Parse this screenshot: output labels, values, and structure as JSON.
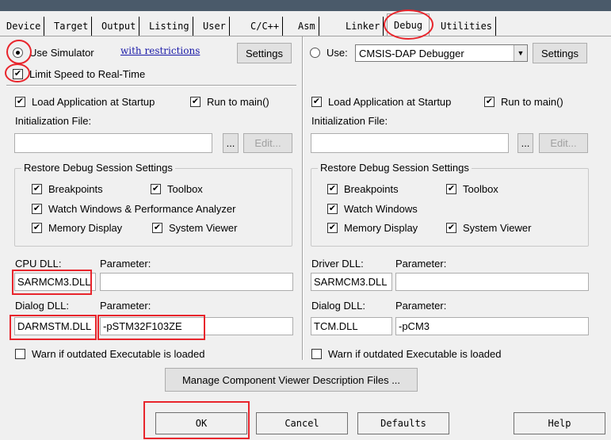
{
  "tabs": [
    {
      "label": "Device"
    },
    {
      "label": "Target"
    },
    {
      "label": "Output"
    },
    {
      "label": "Listing"
    },
    {
      "label": "User"
    },
    {
      "label": "C/C++"
    },
    {
      "label": "Asm"
    },
    {
      "label": "Linker"
    },
    {
      "label": "Debug"
    },
    {
      "label": "Utilities"
    }
  ],
  "active_tab": "Debug",
  "left": {
    "use_simulator": "Use Simulator",
    "restrictions_link": "with restrictions",
    "settings": "Settings",
    "limit_speed": "Limit Speed to Real-Time",
    "load_app": "Load Application at Startup",
    "run_to_main": "Run to main()",
    "init_file_label": "Initialization File:",
    "init_file_value": "",
    "browse": "...",
    "edit": "Edit...",
    "restore_legend": "Restore Debug Session Settings",
    "breakpoints": "Breakpoints",
    "toolbox": "Toolbox",
    "watch_windows": "Watch Windows & Performance Analyzer",
    "memory_display": "Memory Display",
    "system_viewer": "System Viewer",
    "cpu_dll_label": "CPU DLL:",
    "cpu_param_label": "Parameter:",
    "cpu_dll_value": "SARMCM3.DLL",
    "cpu_param_value": "",
    "dialog_dll_label": "Dialog DLL:",
    "dialog_param_label": "Parameter:",
    "dialog_dll_value": "DARMSTM.DLL",
    "dialog_param_value": "-pSTM32F103ZE",
    "warn": "Warn if outdated Executable is loaded"
  },
  "right": {
    "use": "Use:",
    "debugger": "CMSIS-DAP Debugger",
    "settings": "Settings",
    "load_app": "Load Application at Startup",
    "run_to_main": "Run to main()",
    "init_file_label": "Initialization File:",
    "init_file_value": "",
    "browse": "...",
    "edit": "Edit...",
    "restore_legend": "Restore Debug Session Settings",
    "breakpoints": "Breakpoints",
    "toolbox": "Toolbox",
    "watch_windows": "Watch Windows",
    "memory_display": "Memory Display",
    "system_viewer": "System Viewer",
    "driver_dll_label": "Driver DLL:",
    "driver_param_label": "Parameter:",
    "driver_dll_value": "SARMCM3.DLL",
    "driver_param_value": "",
    "dialog_dll_label": "Dialog DLL:",
    "dialog_param_label": "Parameter:",
    "dialog_dll_value": "TCM.DLL",
    "dialog_param_value": "-pCM3",
    "warn": "Warn if outdated Executable is loaded"
  },
  "manage_button": "Manage Component Viewer Description Files ...",
  "footer": {
    "ok": "OK",
    "cancel": "Cancel",
    "defaults": "Defaults",
    "help": "Help"
  },
  "check_glyph": "✔",
  "colors": {
    "annotation_red": "#e8252c",
    "link_blue": "#1a1aa8",
    "window_bg": "#f0f0f0",
    "title_bar": "#4a5a6a"
  }
}
